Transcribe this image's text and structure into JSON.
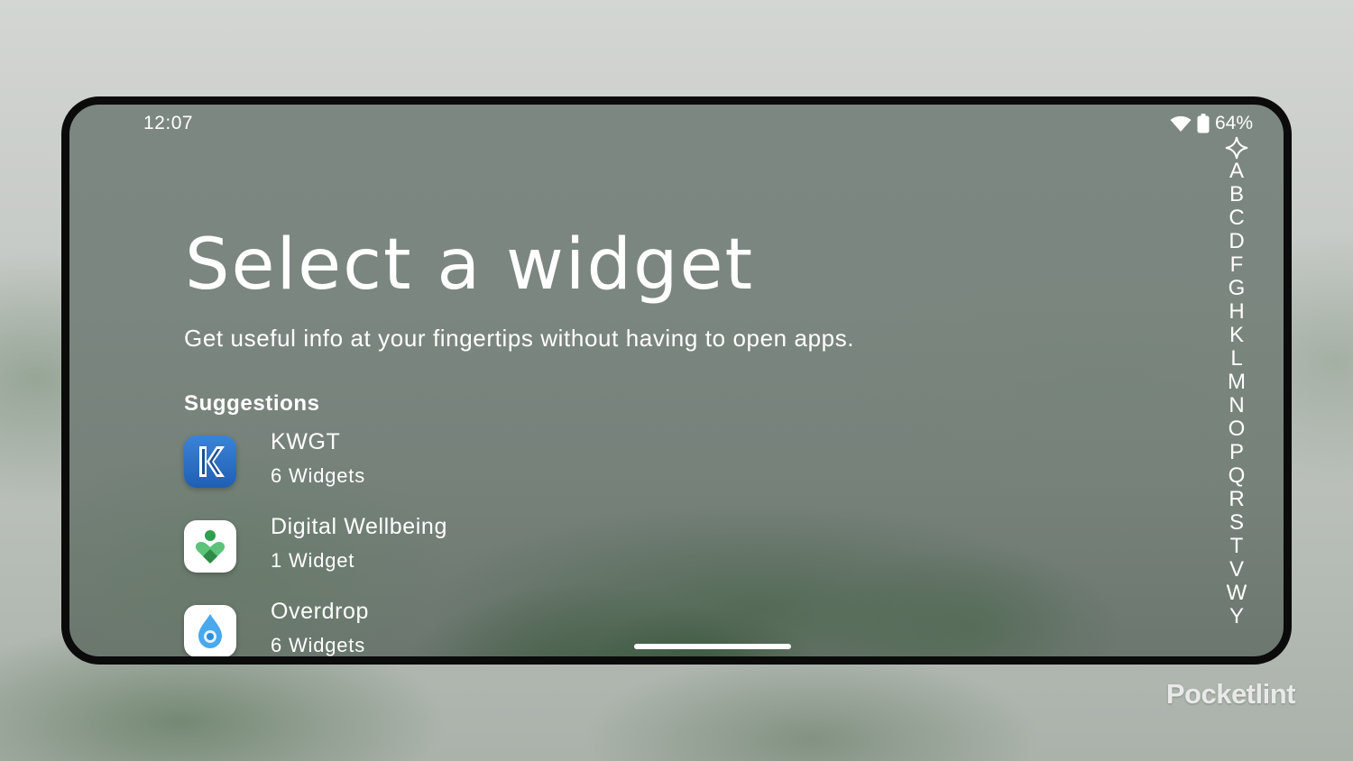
{
  "status_bar": {
    "time": "12:07",
    "battery": "64%",
    "icons": [
      "wifi-icon",
      "battery-icon"
    ]
  },
  "header": {
    "title": "Select a widget",
    "subtitle": "Get useful info at your fingertips without having to open apps."
  },
  "suggestions": {
    "label": "Suggestions",
    "items": [
      {
        "name": "KWGT",
        "count": "6 Widgets",
        "icon": "kwgt-icon"
      },
      {
        "name": "Digital Wellbeing",
        "count": "1 Widget",
        "icon": "digital-wellbeing-icon"
      },
      {
        "name": "Overdrop",
        "count": "6 Widgets",
        "icon": "overdrop-icon"
      }
    ]
  },
  "alphabet_index": {
    "star_icon": "star-outline-icon",
    "letters": [
      "A",
      "B",
      "C",
      "D",
      "F",
      "G",
      "H",
      "K",
      "L",
      "M",
      "N",
      "O",
      "P",
      "Q",
      "R",
      "S",
      "T",
      "V",
      "W",
      "Y"
    ]
  },
  "watermark": "Pocketlint",
  "colors": {
    "text": "#ffffff",
    "kwgt_blue": "#2f6fc4",
    "wellbeing_green": "#3fa55b",
    "overdrop_blue": "#3aa0e8"
  }
}
